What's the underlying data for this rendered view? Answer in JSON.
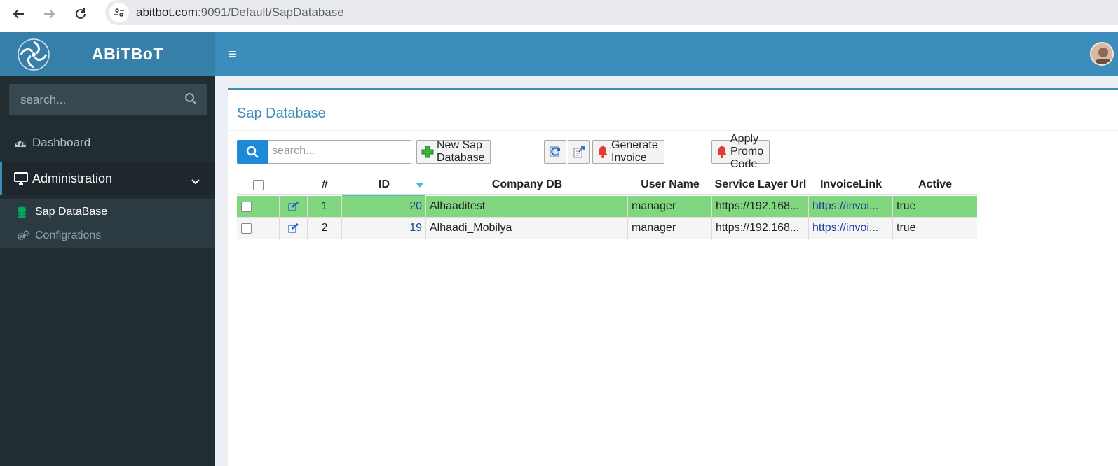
{
  "browser": {
    "url_host": "abitbot.com",
    "url_path": ":9091/Default/SapDatabase"
  },
  "header": {
    "brand": "ABiTBoT",
    "menu_toggle": "≡"
  },
  "sidebar": {
    "search_placeholder": "search...",
    "items": [
      {
        "label": "Dashboard",
        "icon": "dashboard-icon"
      },
      {
        "label": "Administration",
        "icon": "desktop-icon"
      }
    ],
    "subitems": [
      {
        "label": "Sap DataBase",
        "icon": "database-icon"
      },
      {
        "label": "Configrations",
        "icon": "gears-icon"
      }
    ]
  },
  "page": {
    "title": "Sap Database"
  },
  "toolbar": {
    "search_placeholder": "search...",
    "new_label": "New Sap Database",
    "generate_label": "Generate Invoice",
    "promo_label": "Apply Promo Code"
  },
  "grid": {
    "columns": [
      "#",
      "ID",
      "Company DB",
      "User Name",
      "Service Layer Url",
      "InvoiceLink",
      "Active"
    ],
    "rows": [
      {
        "num": "1",
        "id": "20",
        "company": "Alhaaditest",
        "user": "manager",
        "url": "https://192.168...",
        "invoice": "https://invoi...",
        "active": "true"
      },
      {
        "num": "2",
        "id": "19",
        "company": "Alhaadi_Mobilya",
        "user": "manager",
        "url": "https://192.168...",
        "invoice": "https://invoi...",
        "active": "true"
      }
    ]
  },
  "colors": {
    "header_blue": "#3c8dbc",
    "logo_blue": "#367fa9",
    "sidebar_dark": "#222d32",
    "selected_row": "#80d780"
  }
}
